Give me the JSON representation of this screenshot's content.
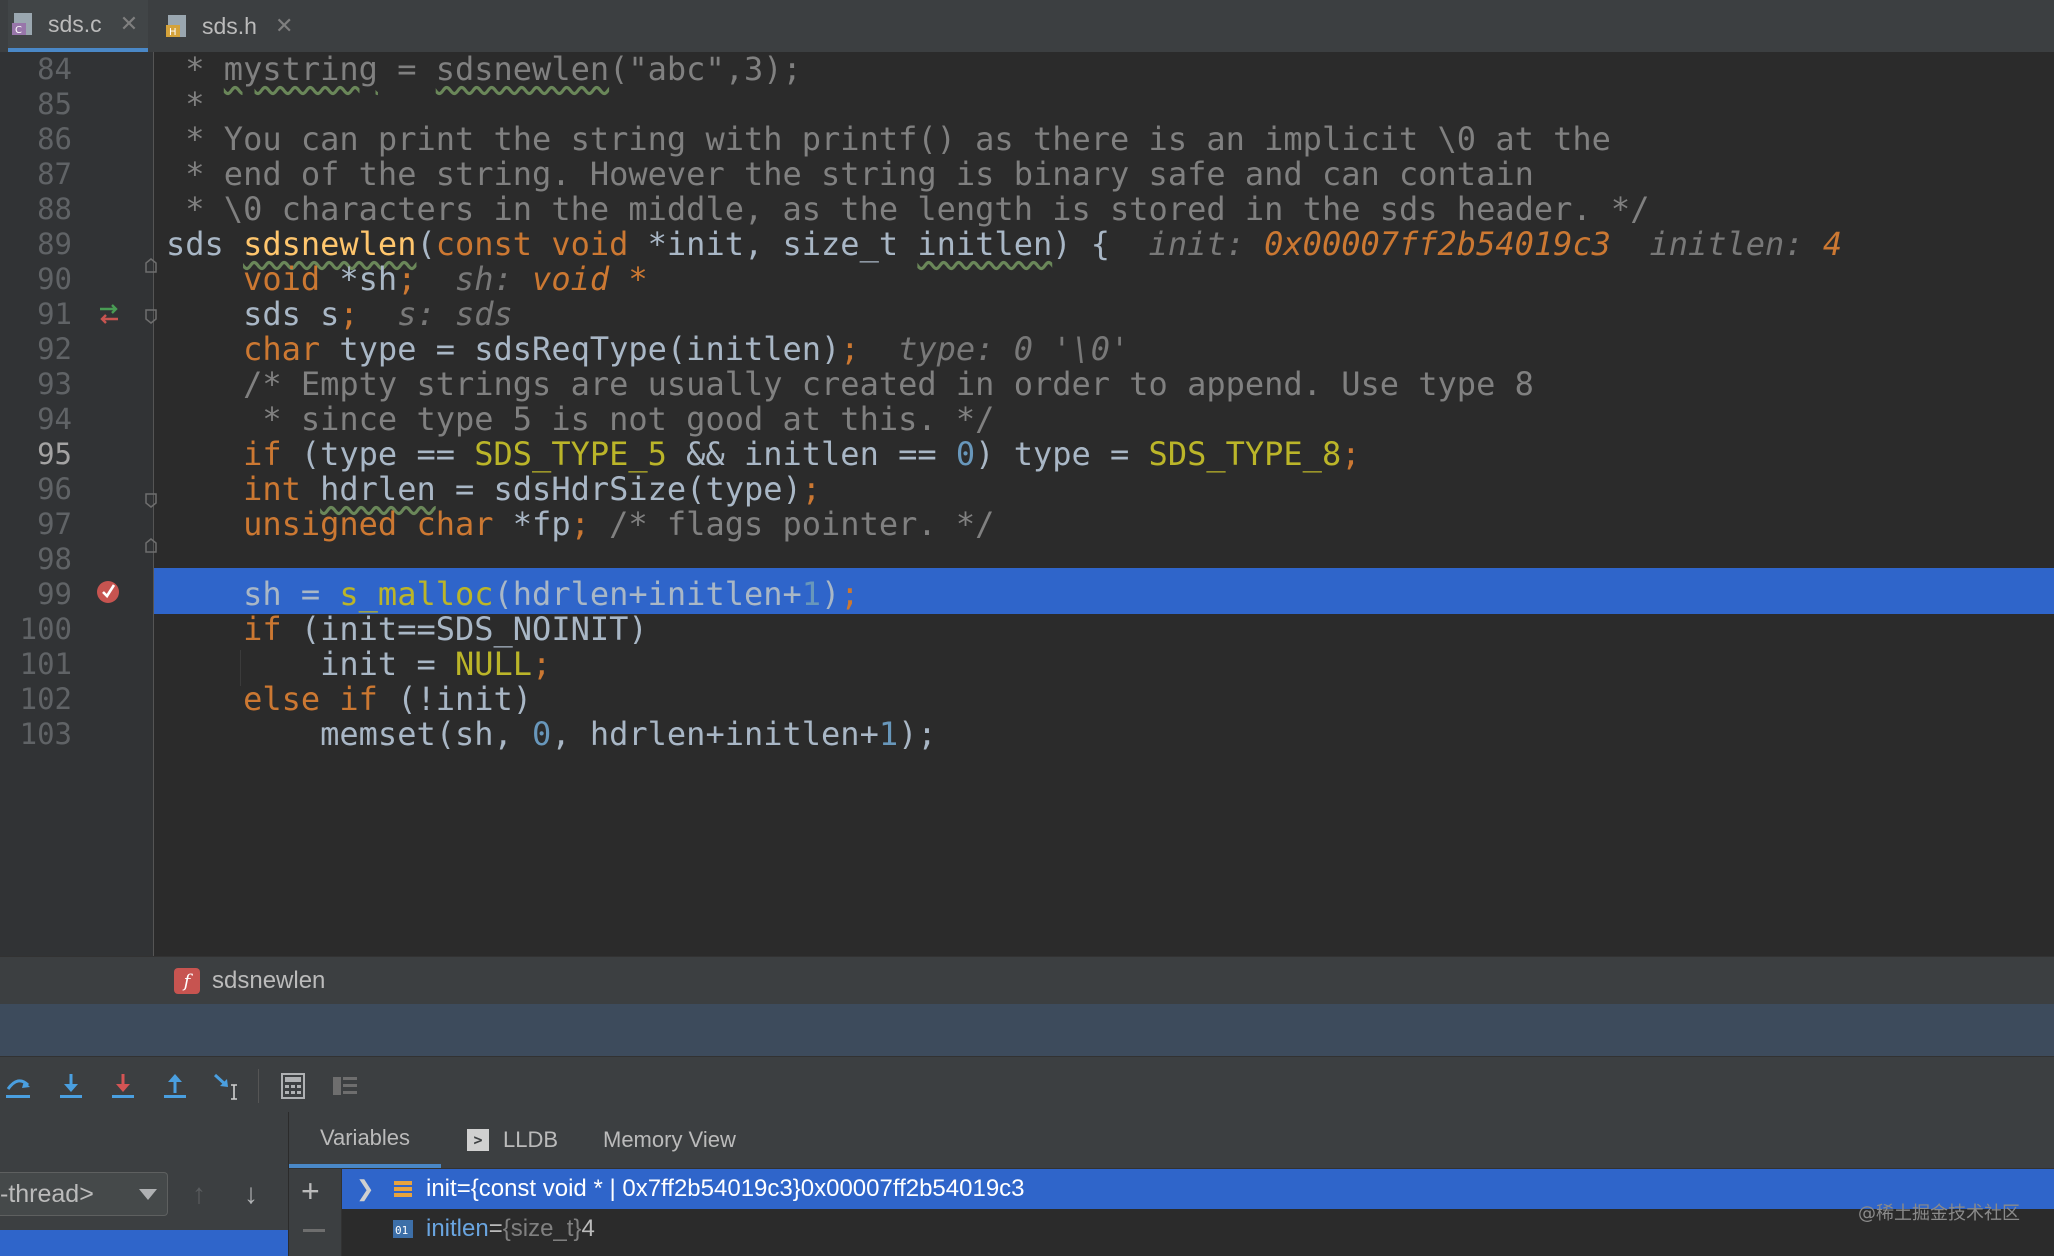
{
  "tabs": [
    {
      "label": "sds.c",
      "icon": "c-file-icon",
      "active": true
    },
    {
      "label": "sds.h",
      "icon": "h-file-icon",
      "active": false
    }
  ],
  "editor": {
    "current_line": 95,
    "lines": [
      {
        "n": "84"
      },
      {
        "n": "85"
      },
      {
        "n": "86"
      },
      {
        "n": "87"
      },
      {
        "n": "88"
      },
      {
        "n": "89"
      },
      {
        "n": "90"
      },
      {
        "n": "91"
      },
      {
        "n": "92"
      },
      {
        "n": "93"
      },
      {
        "n": "94"
      },
      {
        "n": "95"
      },
      {
        "n": "96"
      },
      {
        "n": "97"
      },
      {
        "n": "98"
      },
      {
        "n": "99"
      },
      {
        "n": "100"
      },
      {
        "n": "101"
      },
      {
        "n": "102"
      },
      {
        "n": "103"
      }
    ],
    "code": {
      "l84": {
        "a": " * ",
        "b": "mystring",
        "c": " = ",
        "d": "sdsnewlen",
        "e": "(\"abc\",3);"
      },
      "l85": " *",
      "l86": " * You can print the string with printf() as there is an implicit \\0 at the",
      "l87": " * end of the string. However the string is binary safe and can contain",
      "l88": " * \\0 characters in the middle, as the length is stored in the sds header. */",
      "l89": {
        "t1": "sds ",
        "fn": "sdsnewlen",
        "p1": "(",
        "k1": "const void ",
        "t2": "*init, size_t ",
        "u": "initlen",
        "t3": ") {",
        "h1": "init: ",
        "v1": "0x00007ff2b54019c3",
        "h2": "initlen: ",
        "v2": "4"
      },
      "l90": {
        "k": "void ",
        "t": "*sh",
        "s": ";",
        "h": "sh: ",
        "v": "void *"
      },
      "l91": {
        "t": "sds s",
        "s": ";",
        "h": "s: sds"
      },
      "l92": {
        "k": "char ",
        "t": "type = sdsReqType(initlen)",
        "s": ";",
        "h": "type: 0 '\\0'"
      },
      "l93": "/* Empty strings are usually created in order to append. Use type 8",
      "l94": " * since type 5 is not good at this. */",
      "l95": {
        "k": "if ",
        "t1": "(type == ",
        "m1": "SDS_TYPE_5",
        "t2": " && initlen == ",
        "n": "0",
        "t3": ") type = ",
        "m2": "SDS_TYPE_8",
        "s": ";"
      },
      "l96": {
        "k": "int ",
        "u": "hdrlen",
        "t": " = sdsHdrSize(type)",
        "s": ";"
      },
      "l97": {
        "k": "unsigned char ",
        "t": "*fp",
        "s": ";",
        "c": " /* flags pointer. */"
      },
      "l99": {
        "t1": "sh = ",
        "m": "s_malloc",
        "t2": "(hdrlen+initlen+",
        "n": "1",
        "t3": ")",
        "s": ";"
      },
      "l100": {
        "k": "if ",
        "t": "(init==SDS_NOINIT)"
      },
      "l101": {
        "t": "init = ",
        "m": "NULL",
        "s": ";"
      },
      "l102": {
        "k": "else if ",
        "t": "(!init)"
      },
      "l103": {
        "t1": "memset(sh, ",
        "n1": "0",
        "t2": ", hdrlen+initlen+",
        "n2": "1",
        "t3": ");"
      }
    }
  },
  "breadcrumb": {
    "icon": "f",
    "label": "sdsnewlen"
  },
  "debugger": {
    "toolbar": [
      "step-over-icon",
      "step-into-icon",
      "force-step-into-icon",
      "step-out-icon",
      "run-to-cursor-icon",
      "evaluate-expression-icon",
      "frames-icon"
    ],
    "thread_select": "-thread>",
    "tabs": {
      "variables": "Variables",
      "lldb": "LLDB",
      "memory": "Memory View"
    },
    "variables": [
      {
        "name": "init",
        "eq": " = ",
        "type": "{const void * | 0x7ff2b54019c3}",
        "value": " 0x00007ff2b54019c3",
        "expandable": true
      },
      {
        "name": "initlen",
        "eq": " = ",
        "type": "{size_t}",
        "value": " 4",
        "expandable": false
      }
    ],
    "watermark": "@稀土掘金技术社区"
  },
  "colors": {
    "editor_bg": "#2b2b2b",
    "gutter_bg": "#313335",
    "selection": "#2f65ca",
    "keyword": "#cc7832",
    "macro": "#bbb529",
    "function": "#ffc66d",
    "comment": "#808080",
    "number": "#6897bb"
  }
}
